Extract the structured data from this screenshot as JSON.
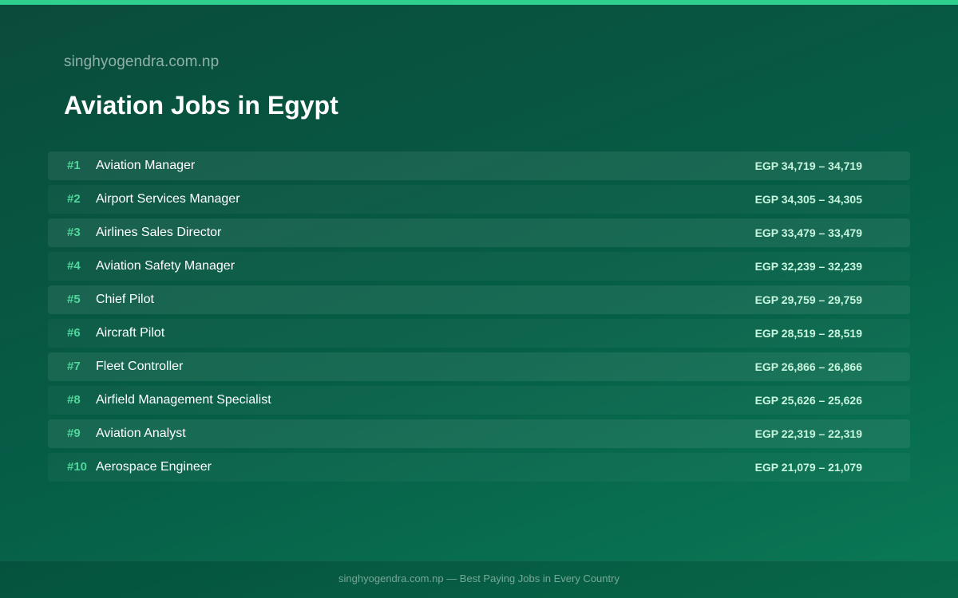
{
  "header": {
    "site_name": "singhyogendra.com.np",
    "title": "Aviation Jobs in Egypt"
  },
  "jobs": [
    {
      "rank": "#1",
      "title": "Aviation Manager",
      "salary": "EGP 34,719 – 34,719"
    },
    {
      "rank": "#2",
      "title": "Airport Services Manager",
      "salary": "EGP 34,305 – 34,305"
    },
    {
      "rank": "#3",
      "title": "Airlines Sales Director",
      "salary": "EGP 33,479 – 33,479"
    },
    {
      "rank": "#4",
      "title": "Aviation Safety Manager",
      "salary": "EGP 32,239 – 32,239"
    },
    {
      "rank": "#5",
      "title": "Chief Pilot",
      "salary": "EGP 29,759 – 29,759"
    },
    {
      "rank": "#6",
      "title": "Aircraft Pilot",
      "salary": "EGP 28,519 – 28,519"
    },
    {
      "rank": "#7",
      "title": "Fleet Controller",
      "salary": "EGP 26,866 – 26,866"
    },
    {
      "rank": "#8",
      "title": "Airfield Management Specialist",
      "salary": "EGP 25,626 – 25,626"
    },
    {
      "rank": "#9",
      "title": "Aviation Analyst",
      "salary": "EGP 22,319 – 22,319"
    },
    {
      "rank": "#10",
      "title": "Aerospace Engineer",
      "salary": "EGP 21,079 – 21,079"
    }
  ],
  "footer": {
    "text": "singhyogendra.com.np — Best Paying Jobs in Every Country"
  },
  "colors": {
    "accent": "#2fcf8e",
    "rank": "#4fd69a",
    "salary": "#c7f5dd"
  }
}
